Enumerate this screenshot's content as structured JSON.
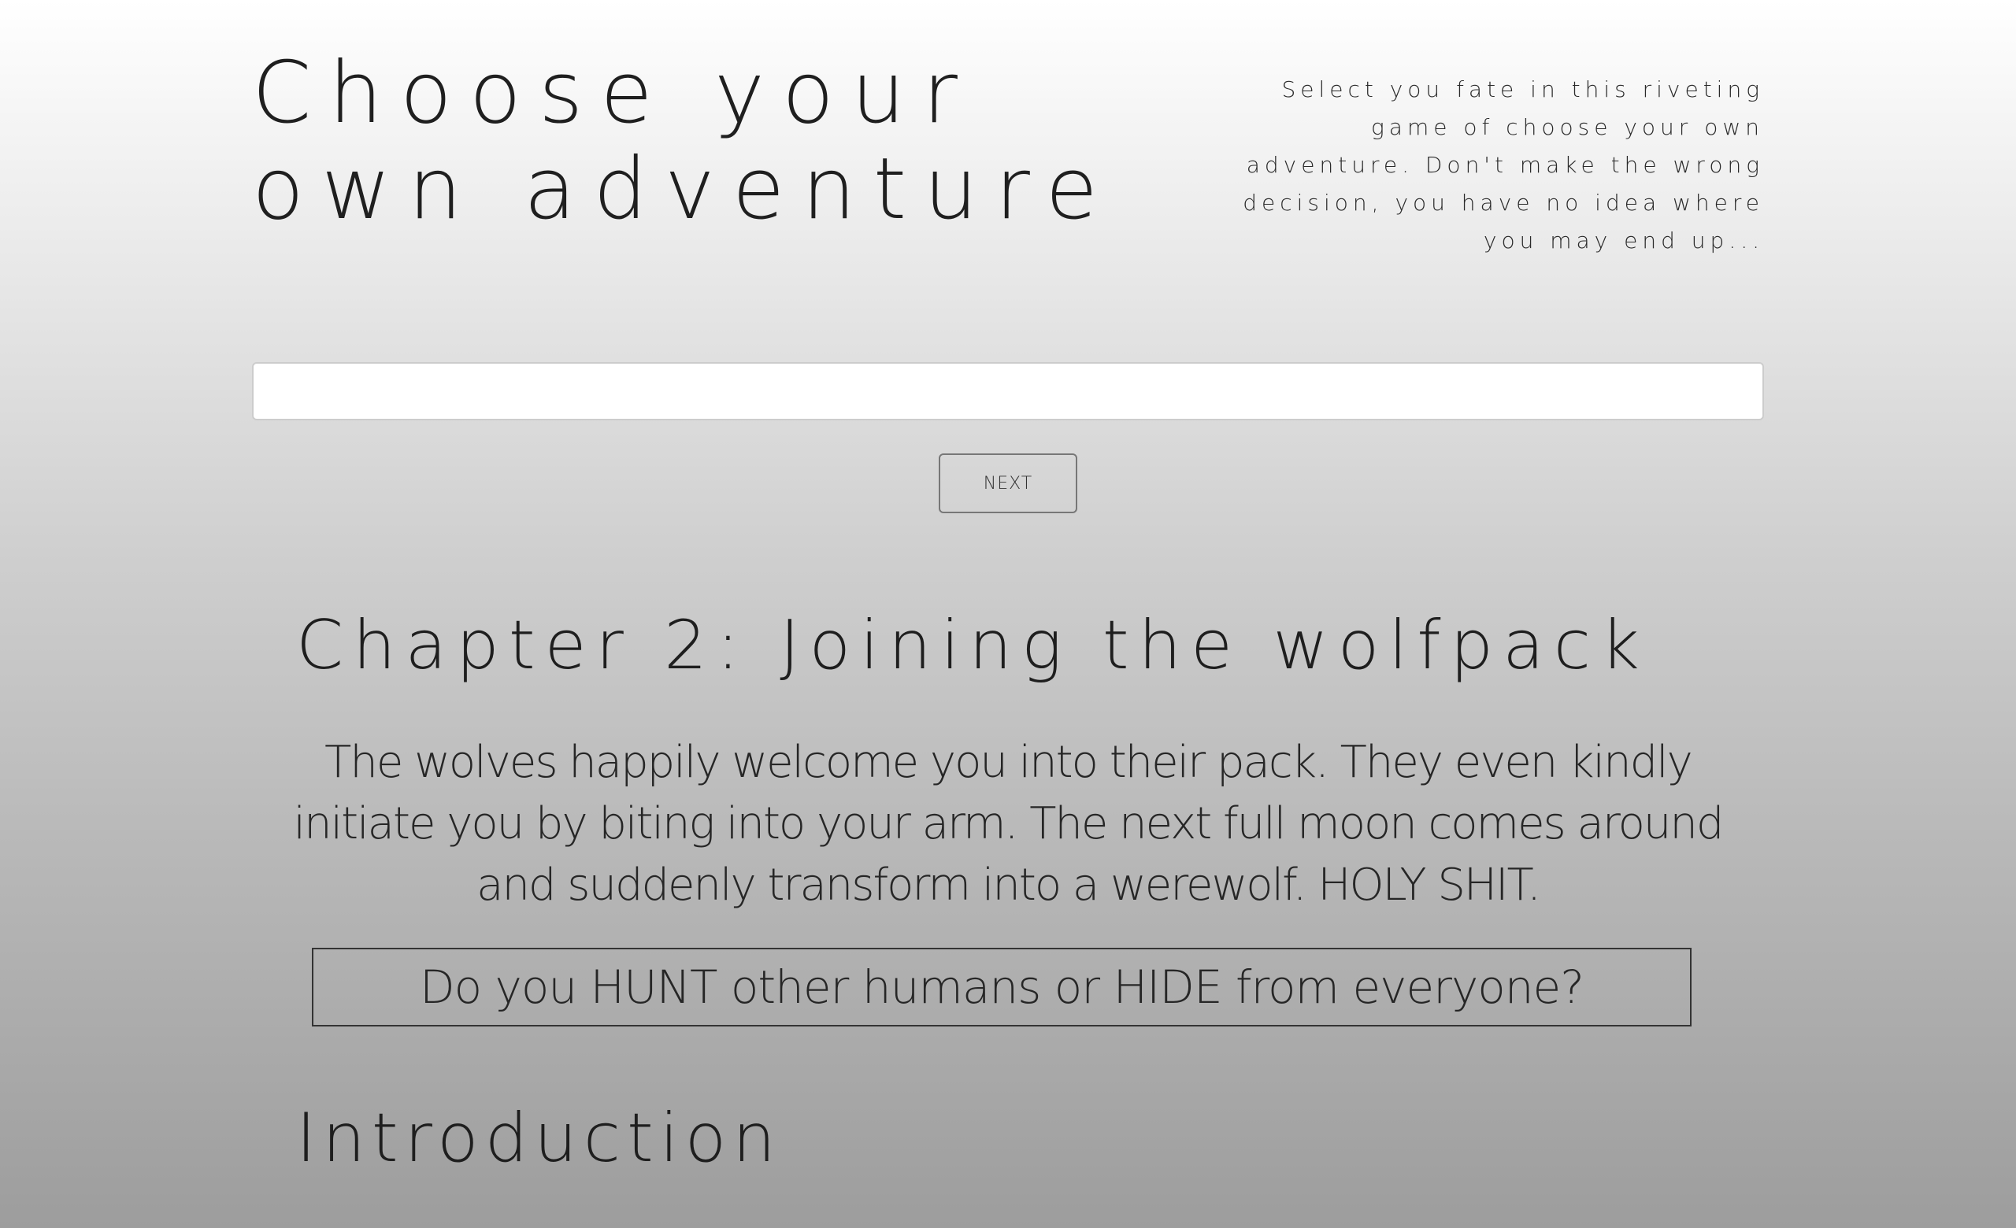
{
  "header": {
    "title": "Choose your own adventure",
    "tagline": "Select you fate in this riveting game of choose your own adventure. Don't make the wrong decision, you have no idea where you may end up..."
  },
  "form": {
    "input_value": "",
    "input_placeholder": "",
    "next_label": "Next"
  },
  "story": {
    "chapter_title": "Chapter 2: Joining the wolfpack",
    "chapter_text": "The wolves happily welcome you into their pack. They even kindly initiate you by biting into your arm. The next full moon comes around and suddenly transform into a werewolf. HOLY SHIT.",
    "question": "Do you HUNT other humans or HIDE from everyone?",
    "next_section_title": "Introduction"
  }
}
